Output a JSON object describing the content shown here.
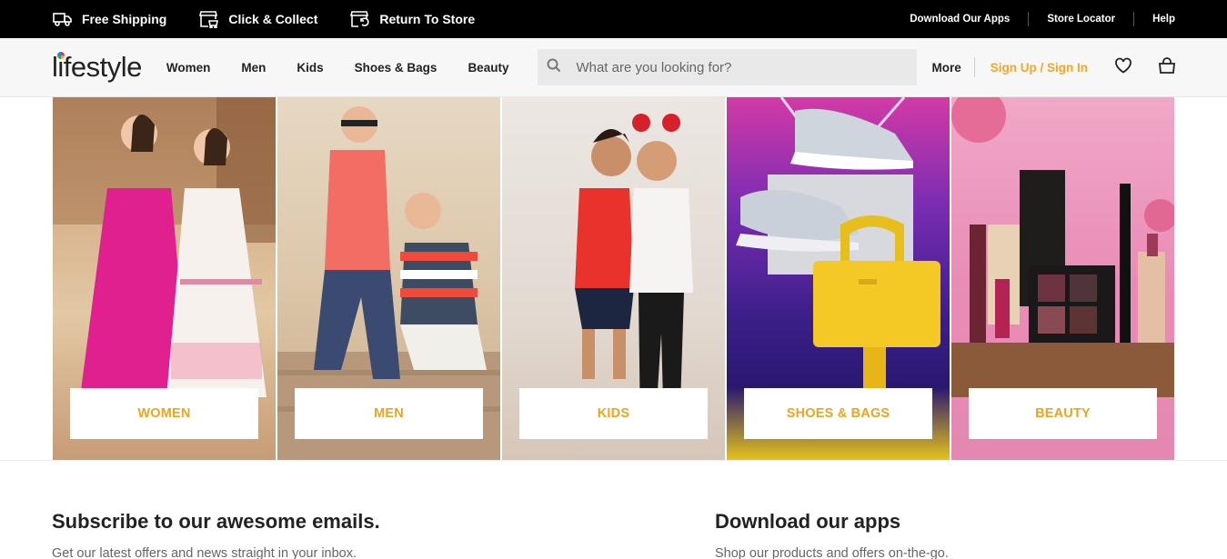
{
  "topbar": {
    "perks": [
      {
        "icon": "truck-icon",
        "label": "Free Shipping"
      },
      {
        "icon": "store-cart-icon",
        "label": "Click & Collect"
      },
      {
        "icon": "store-return-icon",
        "label": "Return To Store"
      }
    ],
    "links": [
      "Download Our Apps",
      "Store Locator",
      "Help"
    ]
  },
  "header": {
    "logo": "lifestyle",
    "nav": [
      "Women",
      "Men",
      "Kids",
      "Shoes & Bags",
      "Beauty"
    ],
    "search_placeholder": "What are you looking for?",
    "more": "More",
    "signin": "Sign Up / Sign In",
    "accent": "#f5a623"
  },
  "tiles": [
    {
      "label": "WOMEN"
    },
    {
      "label": "MEN"
    },
    {
      "label": "KIDS"
    },
    {
      "label": "SHOES & BAGS"
    },
    {
      "label": "BEAUTY"
    }
  ],
  "subscribe": {
    "title": "Subscribe to our awesome emails.",
    "subtitle": "Get our latest offers and news straight in your inbox."
  },
  "apps": {
    "title": "Download our apps",
    "subtitle": "Shop our products and offers on-the-go."
  }
}
